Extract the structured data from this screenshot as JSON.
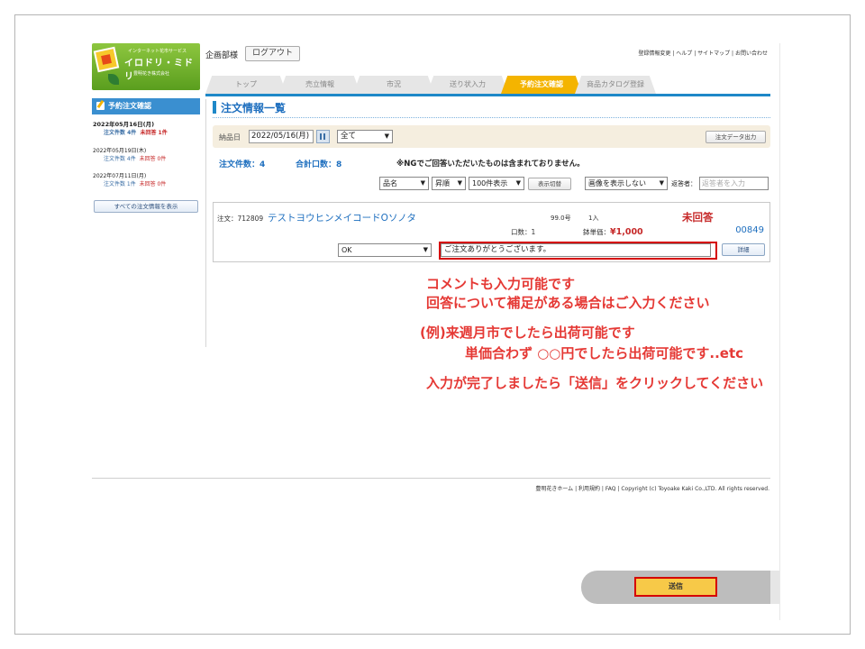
{
  "header": {
    "logo": {
      "tagline": "インターネット花市サービス",
      "brand": "イロドリ・ミドリ",
      "company": "豊明花き株式会社"
    },
    "user_name": "企画部様",
    "logout_label": "ログアウト",
    "top_links": [
      "登録情報変更",
      "ヘルプ",
      "サイトマップ",
      "お問い合わせ"
    ]
  },
  "tabs": [
    {
      "label": "トップ",
      "active": false
    },
    {
      "label": "売立情報",
      "active": false
    },
    {
      "label": "市況",
      "active": false
    },
    {
      "label": "送り状入力",
      "active": false
    },
    {
      "label": "予約注文確認",
      "active": true
    },
    {
      "label": "商品カタログ登録",
      "active": false
    }
  ],
  "sidebar": {
    "title": "予約注文確認",
    "groups": [
      {
        "date": "2022年05月16日(月)",
        "orders_label": "注文件数 4件",
        "pending_label": "未回答 1件"
      },
      {
        "date": "2022年05月19日(木)",
        "orders_label": "注文件数 4件",
        "pending_label": "未回答 0件"
      },
      {
        "date": "2022年07月11日(月)",
        "orders_label": "注文件数 1件",
        "pending_label": "未回答 0件"
      }
    ],
    "all_button_label": "すべての注文情報を表示"
  },
  "main": {
    "page_title": "注文情報一覧",
    "filter": {
      "delivery_label": "納品日",
      "delivery_date": "2022/05/16(月)",
      "status_select": "全て",
      "export_label": "注文データ出力"
    },
    "summary": {
      "order_count": "注文件数：4",
      "total_units": "合計口数：8",
      "ng_note": "※NGでご回答いただいたものは含まれておりません。"
    },
    "sort": {
      "field": "品名",
      "order": "昇順",
      "per_page": "100件表示",
      "toggle_label": "表示切替",
      "image_option": "画像を表示しない",
      "responder_label": "返答者：",
      "responder_placeholder": "返答者を入力"
    },
    "order": {
      "number": "注文：712809",
      "name": "テストヨウヒンメイコードOソノタ",
      "size": "99.0号",
      "unit": "1入",
      "status": "未回答",
      "qty": "口数：1",
      "price_label": "鉢単価：",
      "price": "¥1,000",
      "code": "00849",
      "response_value": "OK",
      "comment": "ご注文ありがとうございます。",
      "detail_label": "詳細"
    }
  },
  "annotations": {
    "line1": "コメントも入力可能です",
    "line2": "回答について補足がある場合はご入力ください",
    "line3": "(例)来週月市でしたら出荷可能です",
    "line4": "単価合わず ○○円でしたら出荷可能です..etc",
    "line5": "入力が完了しましたら「送信」をクリックしてください"
  },
  "footer": {
    "links": "豊明花きホーム | 利用規約 | FAQ |",
    "copyright": "Copyright (c) Toyoake Kaki Co.,LTD. All rights reserved.",
    "send_label": "送信"
  },
  "colors": {
    "accent_blue": "#1e88c8",
    "active_tab": "#f4b400",
    "highlight_red": "#d50000",
    "annotation_red": "#e53935"
  }
}
